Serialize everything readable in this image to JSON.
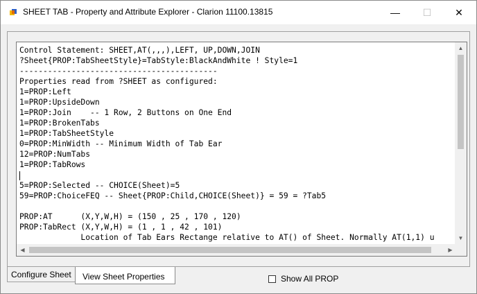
{
  "window": {
    "title": "SHEET TAB - Property and Attribute Explorer - Clarion 11100.13815",
    "app_icon": "clarion-app-icon",
    "buttons": {
      "minimize": "—",
      "maximize": "☐",
      "close": "✕"
    }
  },
  "content": {
    "lines": [
      "Control Statement: SHEET,AT(,,,),LEFT, UP,DOWN,JOIN",
      "?Sheet{PROP:TabSheetStyle}=TabStyle:BlackAndWhite ! Style=1",
      "------------------------------------------",
      "Properties read from ?SHEET as configured:",
      "1=PROP:Left",
      "1=PROP:UpsideDown",
      "1=PROP:Join    -- 1 Row, 2 Buttons on One End",
      "1=PROP:BrokenTabs",
      "1=PROP:TabSheetStyle",
      "0=PROP:MinWidth -- Minimum Width of Tab Ear",
      "12=PROP:NumTabs",
      "1=PROP:TabRows",
      "",
      "5=PROP:Selected -- CHOICE(Sheet)=5",
      "59=PROP:ChoiceFEQ -- Sheet{PROP:Child,CHOICE(Sheet)} = 59 = ?Tab5",
      "",
      "PROP:AT      (X,Y,W,H) = (150 , 25 , 170 , 120)",
      "PROP:TabRect (X,Y,W,H) = (1 , 1 , 42 , 101)",
      "             Location of Tab Ears Rectange relative to AT() of Sheet. Normally AT(1,1) u"
    ]
  },
  "tabs": [
    {
      "label": "Configure Sheet",
      "selected": false
    },
    {
      "label": "View Sheet Properties",
      "selected": true
    }
  ],
  "show_all_prop": {
    "label": "Show All PROP",
    "checked": false
  },
  "scrollbar_icons": {
    "up": "▲",
    "down": "▼",
    "left": "◀",
    "right": "▶"
  }
}
